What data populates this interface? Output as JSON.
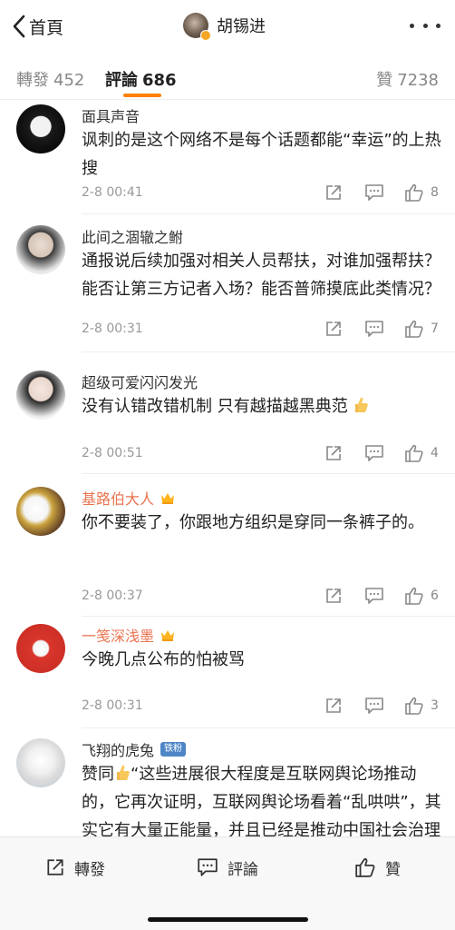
{
  "header": {
    "back_label": "首頁",
    "title": "胡锡进"
  },
  "tabs": [
    {
      "label": "轉發",
      "count": "452"
    },
    {
      "label": "評論",
      "count": "686"
    },
    {
      "label": "贊",
      "count": "7238"
    }
  ],
  "comments": [
    {
      "name": "面具声音",
      "text": "讽刺的是这个网络不是每个话题都能“幸运”的上热搜",
      "time": "2-8 00:41",
      "likes": "8"
    },
    {
      "name": "此间之涸辙之鲋",
      "text": "通报说后续加强对相关人员帮扶，对谁加强帮扶？能否让第三方记者入场？能否普筛摸底此类情况？",
      "time": "2-8 00:31",
      "likes": "7"
    },
    {
      "name": "超级可爱闪闪发光",
      "text": "没有认错改错机制 只有越描越黑典范",
      "time": "2-8 00:51",
      "likes": "4"
    },
    {
      "name": "基路伯大人",
      "text": "你不要装了，你跟地方组织是穿同一条裤子的。",
      "time": "2-8 00:37",
      "likes": "6"
    },
    {
      "name": "一笺深浅墨",
      "text": "今晚几点公布的怕被骂",
      "time": "2-8 00:31",
      "likes": "3"
    },
    {
      "name": "飞翔的虎兔",
      "badge": "铁粉",
      "text_prefix": "赞同",
      "text": "“这些进展很大程度是互联网舆论场推动的，它再次证明，互联网舆论场看着“乱哄哄”，其实它有大量正能量，并且已经是推动中国社会治理进步动力机制中不可或缺的一部分。”"
    }
  ],
  "bottom": {
    "repost": "轉發",
    "comment": "評論",
    "like": "贊"
  },
  "colors": {
    "accent": "#ff8200",
    "gold_name": "#eb7350",
    "fans_badge": "#4f86c6"
  },
  "icons": [
    "back-chevron-icon",
    "more-dots-icon",
    "share-icon",
    "reply-icon",
    "thumb-up-icon",
    "crown-icon"
  ]
}
